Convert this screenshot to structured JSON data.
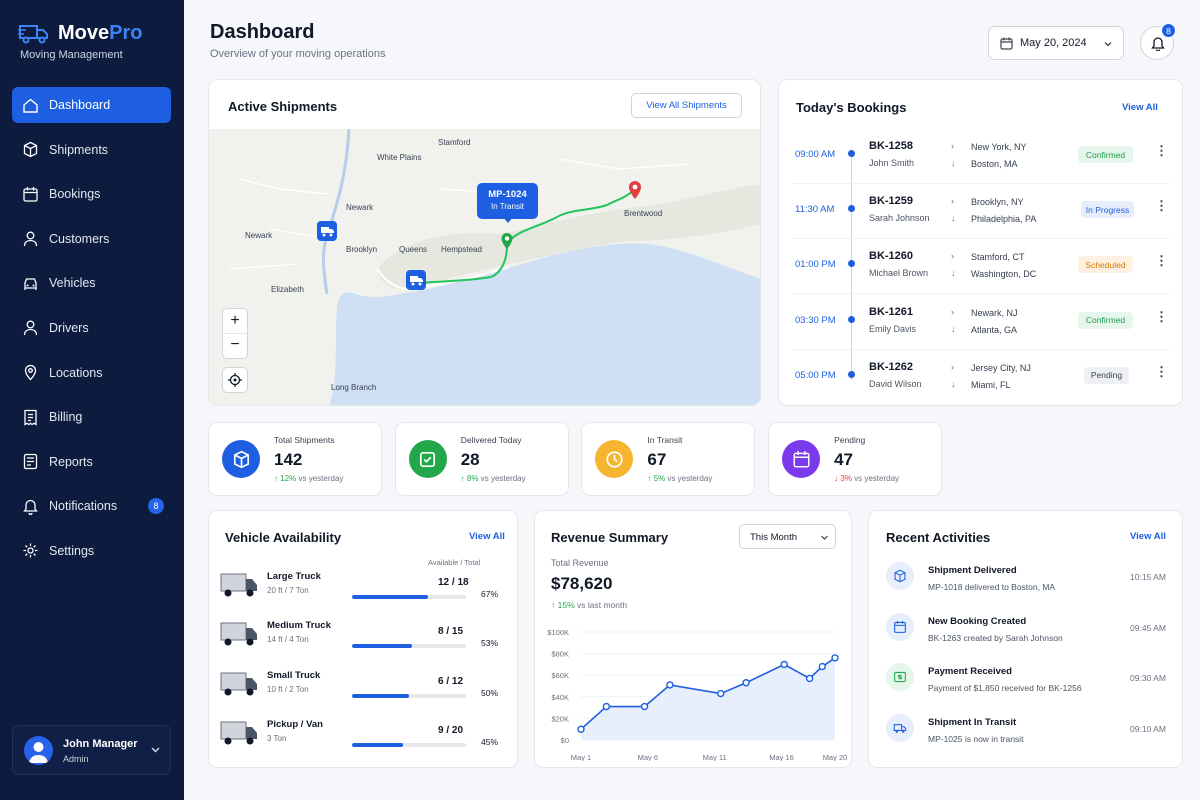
{
  "brand": {
    "name_a": "Move",
    "name_b": "Pro",
    "subtitle": "Moving Management"
  },
  "nav": [
    {
      "label": "Dashboard",
      "icon": "home-icon"
    },
    {
      "label": "Shipments",
      "icon": "box-icon"
    },
    {
      "label": "Bookings",
      "icon": "calendar-icon"
    },
    {
      "label": "Customers",
      "icon": "user-icon"
    },
    {
      "label": "Vehicles",
      "icon": "car-icon"
    },
    {
      "label": "Drivers",
      "icon": "user-icon"
    },
    {
      "label": "Locations",
      "icon": "pin-icon"
    },
    {
      "label": "Billing",
      "icon": "receipt-icon"
    },
    {
      "label": "Reports",
      "icon": "report-icon"
    },
    {
      "label": "Notifications",
      "icon": "bell-icon",
      "badge": "8"
    },
    {
      "label": "Settings",
      "icon": "gear-icon"
    }
  ],
  "user": {
    "name": "John Manager",
    "role": "Admin"
  },
  "header": {
    "title": "Dashboard",
    "subtitle": "Overview of your moving operations",
    "date": "May 20, 2024",
    "notif_count": "8"
  },
  "shipments": {
    "title": "Active Shipments",
    "button": "View All Shipments",
    "map_labels": [
      "Stamford",
      "White Plains",
      "Newark",
      "Newark",
      "Brooklyn",
      "Queens",
      "Hempstead",
      "Elizabeth",
      "Long Branch",
      "Brentwood"
    ],
    "tooltip": {
      "id": "MP-1024",
      "status": "In Transit"
    }
  },
  "bookings": {
    "title": "Today's Bookings",
    "view_all": "View All",
    "rows": [
      {
        "time": "09:00 AM",
        "id": "BK-1258",
        "name": "John Smith",
        "from": "New York, NY",
        "to": "Boston, MA",
        "status": "Confirmed"
      },
      {
        "time": "11:30 AM",
        "id": "BK-1259",
        "name": "Sarah Johnson",
        "from": "Brooklyn, NY",
        "to": "Philadelphia, PA",
        "status": "In Progress"
      },
      {
        "time": "01:00 PM",
        "id": "BK-1260",
        "name": "Michael Brown",
        "from": "Stamford, CT",
        "to": "Washington, DC",
        "status": "Scheduled"
      },
      {
        "time": "03:30 PM",
        "id": "BK-1261",
        "name": "Emily Davis",
        "from": "Newark, NJ",
        "to": "Atlanta, GA",
        "status": "Confirmed"
      },
      {
        "time": "05:00 PM",
        "id": "BK-1262",
        "name": "David Wilson",
        "from": "Jersey City, NJ",
        "to": "Miami, FL",
        "status": "Pending"
      }
    ]
  },
  "stats": [
    {
      "label": "Total Shipments",
      "value": "142",
      "change": "12%",
      "suffix": "vs yesterday",
      "dir": "up",
      "color": "#1d5fe0",
      "icon": "cube-icon"
    },
    {
      "label": "Delivered Today",
      "value": "28",
      "change": "8%",
      "suffix": "vs yesterday",
      "dir": "up",
      "color": "#22a84a",
      "icon": "check-icon"
    },
    {
      "label": "In Transit",
      "value": "67",
      "change": "5%",
      "suffix": "vs yesterday",
      "dir": "up",
      "color": "#f5b52e",
      "icon": "clock-icon"
    },
    {
      "label": "Pending",
      "value": "47",
      "change": "3%",
      "suffix": "vs yesterday",
      "dir": "down",
      "color": "#7c3aed",
      "icon": "calendar-icon"
    }
  ],
  "vehicles": {
    "title": "Vehicle Availability",
    "view_all": "View All",
    "col_header": "Available / Total",
    "rows": [
      {
        "name": "Large Truck",
        "spec": "20 ft / 7 Ton",
        "count": "12 / 18",
        "pct": "67%",
        "fill": 0.67
      },
      {
        "name": "Medium Truck",
        "spec": "14 ft / 4 Ton",
        "count": "8 / 15",
        "pct": "53%",
        "fill": 0.53
      },
      {
        "name": "Small Truck",
        "spec": "10 ft / 2 Ton",
        "count": "6 / 12",
        "pct": "50%",
        "fill": 0.5
      },
      {
        "name": "Pickup / Van",
        "spec": "3 Ton",
        "count": "9 / 20",
        "pct": "45%",
        "fill": 0.45
      }
    ]
  },
  "revenue": {
    "title": "Revenue Summary",
    "period": "This Month",
    "total_label": "Total Revenue",
    "total": "$78,620",
    "change": "15%",
    "change_suffix": "vs last month"
  },
  "chart_data": {
    "type": "line",
    "x": [
      "May 1",
      "May 2",
      "May 3",
      "May 4",
      "May 5",
      "May 6",
      "May 7",
      "May 8",
      "May 9",
      "May 10",
      "May 11",
      "May 12",
      "May 13",
      "May 14",
      "May 15",
      "May 16",
      "May 17",
      "May 18",
      "May 19",
      "May 20"
    ],
    "xtick_labels": [
      "May 1",
      "May 6",
      "May 11",
      "May 16",
      "May 20"
    ],
    "ytick_labels": [
      "$0",
      "$20K",
      "$40K",
      "$60K",
      "$80K",
      "$100K"
    ],
    "values": [
      10000,
      31000,
      31000,
      51000,
      43000,
      53000,
      70000,
      57000,
      68000,
      76000
    ],
    "x_index": [
      0,
      2,
      5,
      7,
      11,
      13,
      16,
      18,
      19,
      20
    ],
    "ylim": [
      0,
      100000
    ]
  },
  "activities": {
    "title": "Recent Activities",
    "view_all": "View All",
    "rows": [
      {
        "title": "Shipment Delivered",
        "desc": "MP-1018 delivered to Boston, MA",
        "time": "10:15 AM",
        "icon": "box-icon"
      },
      {
        "title": "New Booking Created",
        "desc": "BK-1263 created by Sarah Johnson",
        "time": "09:45 AM",
        "icon": "calendar-icon"
      },
      {
        "title": "Payment Received",
        "desc": "Payment of $1,850 received for BK-1256",
        "time": "09:30 AM",
        "icon": "money-icon"
      },
      {
        "title": "Shipment In Transit",
        "desc": "MP-1025 is now in transit",
        "time": "09:10 AM",
        "icon": "truck-icon"
      }
    ]
  }
}
